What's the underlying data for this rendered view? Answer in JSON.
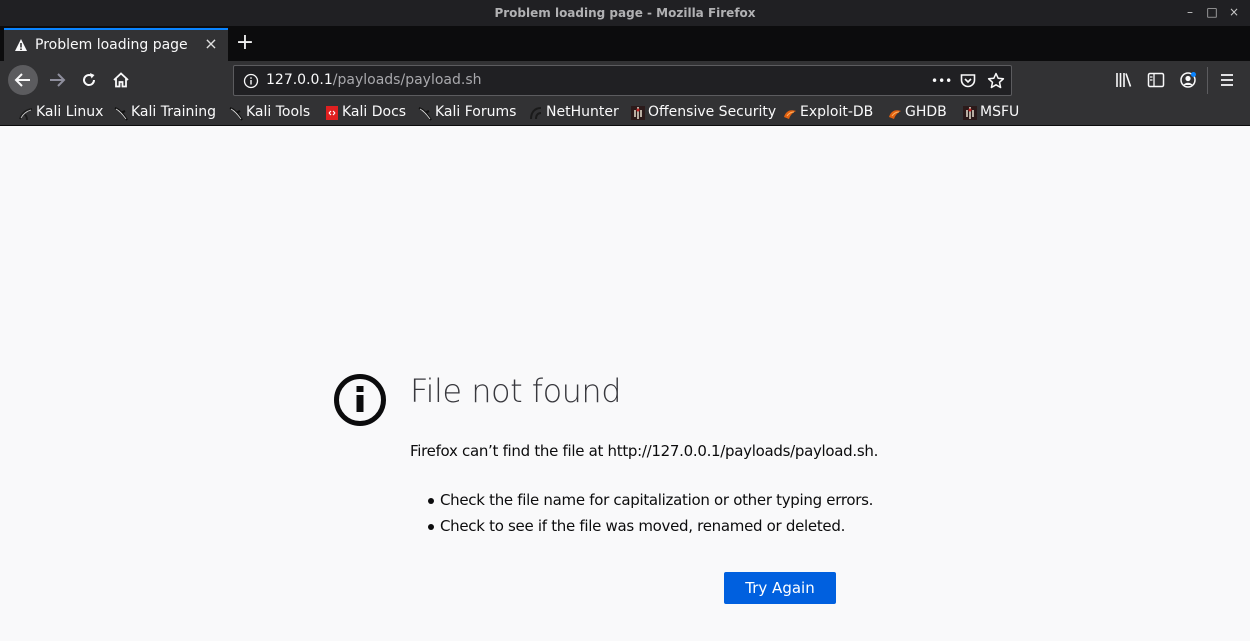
{
  "window": {
    "title": "Problem loading page - Mozilla Firefox",
    "minimize": "–",
    "maximize": "□",
    "close": "×"
  },
  "tab": {
    "label": "Problem loading page",
    "close": "×",
    "new_tab": "+"
  },
  "urlbar": {
    "host": "127.0.0.1",
    "path": "/payloads/payload.sh",
    "more": "•••"
  },
  "bookmarks": [
    {
      "label": "Kali Linux",
      "icon": "kali-dragon-icon"
    },
    {
      "label": "Kali Training",
      "icon": "kali-dragon-icon"
    },
    {
      "label": "Kali Tools",
      "icon": "kali-dragon-icon"
    },
    {
      "label": "Kali Docs",
      "icon": "kali-docs-icon"
    },
    {
      "label": "Kali Forums",
      "icon": "kali-dragon-icon"
    },
    {
      "label": "NetHunter",
      "icon": "nethunter-icon"
    },
    {
      "label": "Offensive Security",
      "icon": "offsec-icon"
    },
    {
      "label": "Exploit-DB",
      "icon": "exploit-db-icon"
    },
    {
      "label": "GHDB",
      "icon": "ghdb-icon"
    },
    {
      "label": "MSFU",
      "icon": "msfu-icon"
    }
  ],
  "error": {
    "title": "File not found",
    "description": "Firefox can’t find the file at http://127.0.0.1/payloads/payload.sh.",
    "tips": [
      "Check the file name for capitalization or other typing errors.",
      "Check to see if the file was moved, renamed or deleted."
    ],
    "button": "Try Again"
  },
  "colors": {
    "accent": "#0a84ff",
    "button": "#0060df",
    "toolbar": "#323234",
    "tabstrip": "#0c0c0d",
    "page": "#f9f9fa"
  }
}
